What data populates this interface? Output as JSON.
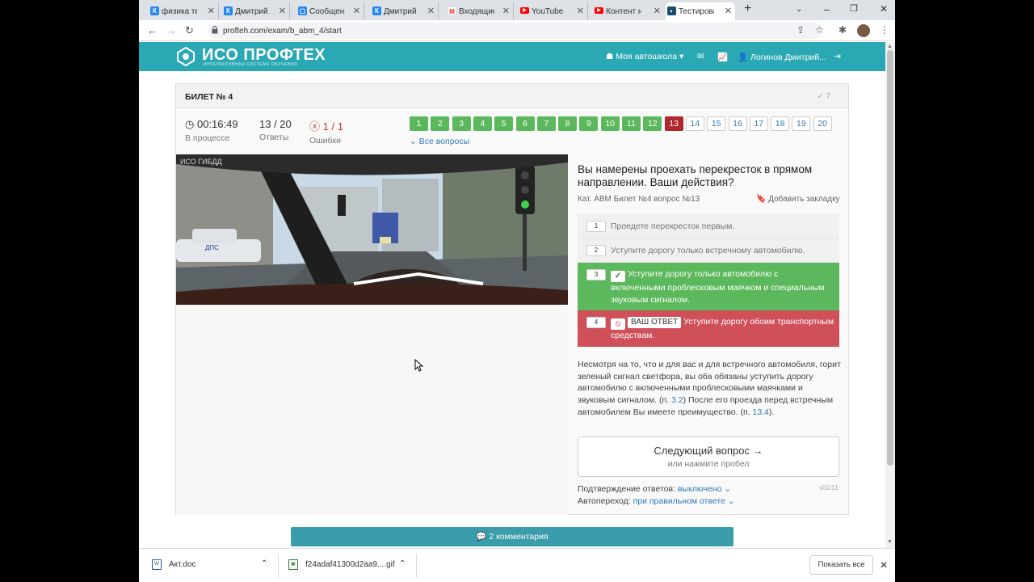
{
  "browser": {
    "tabs": [
      {
        "label": "физика те",
        "icon": "vk"
      },
      {
        "label": "Дмитрий Л",
        "icon": "vk"
      },
      {
        "label": "Сообщени",
        "icon": "messenger"
      },
      {
        "label": "Дмитрий Л",
        "icon": "vk"
      },
      {
        "label": "Входящие",
        "icon": "gmail"
      },
      {
        "label": "YouTube",
        "icon": "youtube"
      },
      {
        "label": "Контент н",
        "icon": "youtube"
      },
      {
        "label": "Тестирова",
        "icon": "profteh",
        "active": true
      }
    ],
    "url": "profteh.com/exam/b_abm_4/start"
  },
  "site": {
    "logo_title": "ИСО ПРОФТЕХ",
    "logo_subtitle": "ИНТЕРАКТИВНАЯ СИСТЕМА ОБУЧЕНИЯ",
    "nav_school": "Моя автошкола",
    "nav_user": "Логинов Дмитрий...",
    "accent_color": "#2aa8b4"
  },
  "ticket": {
    "title": "БИЛЕТ № 4",
    "answered_count": "7",
    "timer_value": "00:16:49",
    "timer_label": "В процессе",
    "answers_value": "13 / 20",
    "answers_label": "Ответы",
    "errors_value": "1 / 1",
    "errors_label": "Ошибки",
    "question_numbers": [
      "1",
      "2",
      "3",
      "4",
      "5",
      "6",
      "7",
      "8",
      "9",
      "10",
      "11",
      "12",
      "13",
      "14",
      "15",
      "16",
      "17",
      "18",
      "19",
      "20"
    ],
    "question_states": [
      "ok",
      "ok",
      "ok",
      "ok",
      "ok",
      "ok",
      "ok",
      "ok",
      "ok",
      "ok",
      "ok",
      "ok",
      "cur",
      "open",
      "open",
      "open",
      "open",
      "open",
      "open",
      "open"
    ],
    "all_questions": "Все вопросы"
  },
  "question": {
    "text": "Вы намерены проехать перекресток в прямом направлении. Ваши действия?",
    "meta": "Кат. ABM   Билет №4   вопрос №13",
    "bookmark": "Добавить закладку",
    "answers": [
      {
        "num": "1",
        "text": "Проедете перекресток первым.",
        "state": "plain"
      },
      {
        "num": "2",
        "text": "Уступите дорогу только встречному автомобилю.",
        "state": "plain"
      },
      {
        "num": "3",
        "text": "Уступите дорогу только автомобилю с включенными проблесковым маячком и специальным звуковым сигналом.",
        "state": "correct"
      },
      {
        "num": "4",
        "badge": "ВАШ ОТВЕТ",
        "text": "Уступите дорогу обоим транспортным средствам.",
        "state": "wrong"
      }
    ],
    "explanation_a": "Несмотря на то, что и для  вас и для встречного автомобиля, горит зеленый сигнал светфора, вы оба  обязаны уступить дорогу автомобилю  с включенными проблесковыми маячками и звуковым сигналом. (п.",
    "link_a": "3.2",
    "explanation_b": ") После его проезда  перед встречным автомобилем Вы имеете преимущество.  (п.",
    "link_b": "13.4",
    "explanation_c": ").",
    "next_label": "Следующий вопрос →",
    "next_hint": "или нажмите пробел",
    "version": "v01/11",
    "confirm_label": "Подтверждение ответов:",
    "confirm_value": "выключено",
    "auto_label": "Автопереход:",
    "auto_value": "при правильном ответе",
    "photo_watermark": "ИСО ГИБДД",
    "photo_sign": "ДПС"
  },
  "comments_label": "2 комментария",
  "downloads": {
    "items": [
      "Акт.doc",
      "f24adaf41300d2aa9....gif"
    ],
    "show_all": "Показать все"
  }
}
